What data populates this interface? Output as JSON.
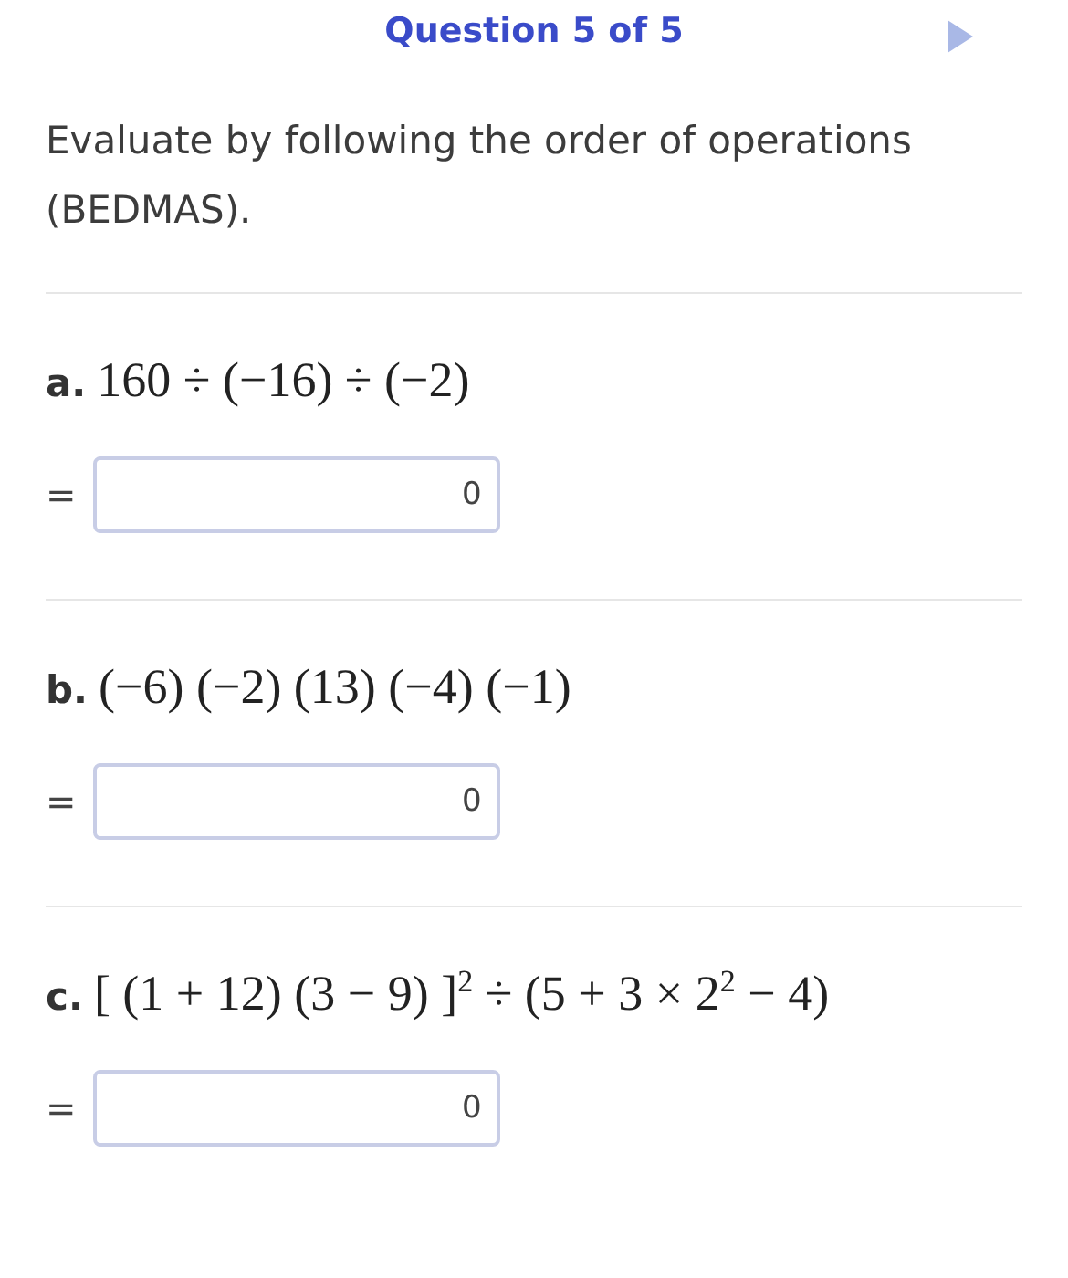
{
  "header": {
    "title": "Question 5 of 5"
  },
  "instructions": "Evaluate by following the order of operations (BEDMAS).",
  "parts": [
    {
      "label": "a.",
      "expression": "160 ÷ (−16) ÷ (−2)",
      "equals": "=",
      "answer": "0"
    },
    {
      "label": "b.",
      "expression": "(−6) (−2) (13) (−4) (−1)",
      "equals": "=",
      "answer": "0"
    },
    {
      "label": "c.",
      "expression": "[ (1 + 12) (3 − 9) ]$^{2}$ ÷ (5 + 3 × 2$^{2}$ − 4)",
      "equals": "=",
      "answer": "0"
    }
  ]
}
